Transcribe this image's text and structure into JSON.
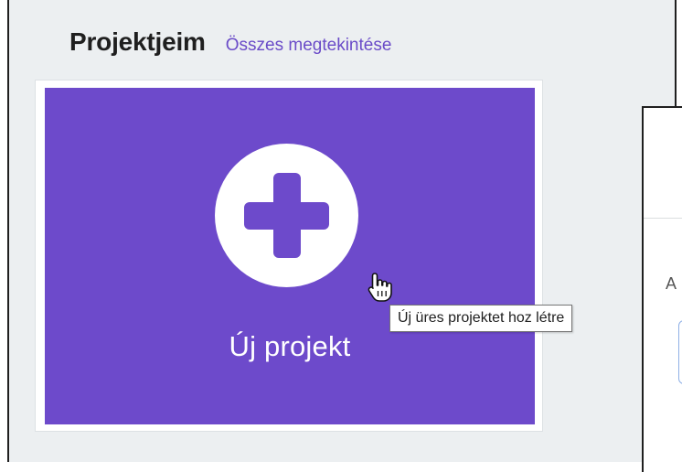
{
  "header": {
    "title": "Projektjeim",
    "view_all_link": "Összes megtekintése"
  },
  "new_project_card": {
    "label": "Új projekt",
    "icon": "plus-circle-icon",
    "tooltip": "Új üres projektet hoz létre"
  },
  "side_panel": {
    "visible_char": "A"
  },
  "colors": {
    "accent": "#6d4acb",
    "link": "#6a4bc8",
    "page_background": "#eceff1"
  }
}
